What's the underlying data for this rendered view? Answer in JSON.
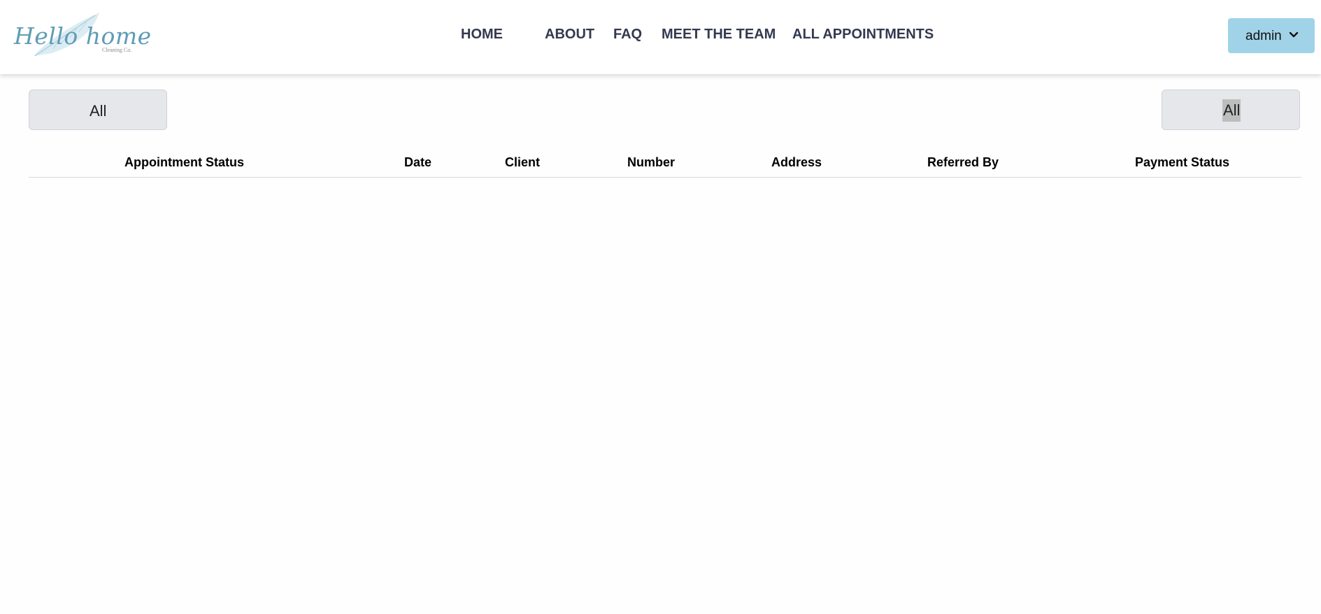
{
  "brand": {
    "logo_script": "Hello home",
    "logo_subtitle": "Cleaning Co.",
    "accent_color": "#5f9cb5"
  },
  "nav": {
    "home": "HOME",
    "about": "ABOUT",
    "faq": "FAQ",
    "team": "MEET THE TEAM",
    "appointments": "ALL APPOINTMENTS"
  },
  "user_menu": {
    "label": "admin",
    "icon": "chevron-down-icon",
    "color": "#a0d3e8"
  },
  "filters": {
    "left_label": "All",
    "right_label": "All"
  },
  "table": {
    "columns": [
      "Appointment Status",
      "Date",
      "Client",
      "Number",
      "Address",
      "Referred By",
      "Payment Status"
    ],
    "rows": []
  }
}
